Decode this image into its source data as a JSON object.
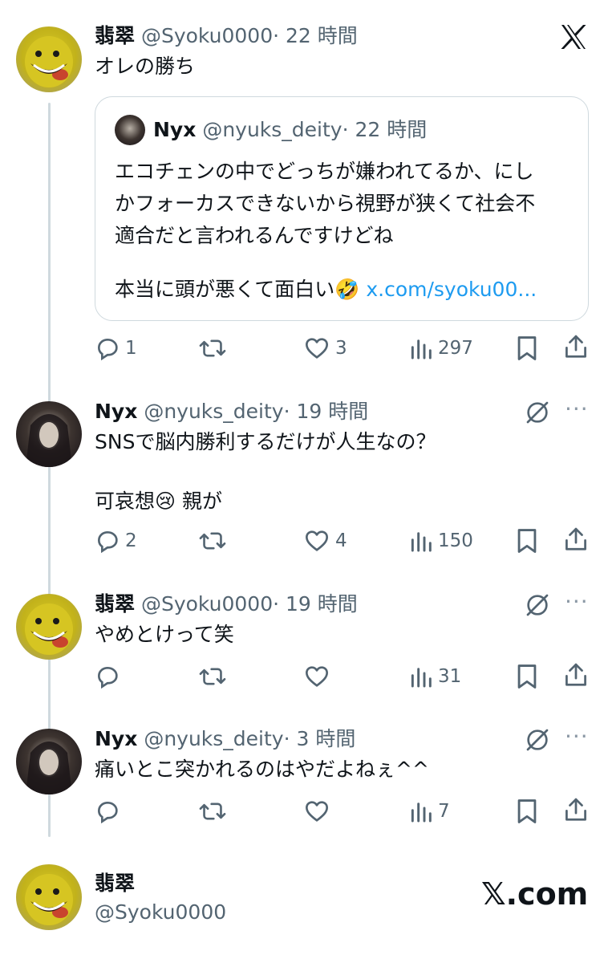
{
  "header": {
    "brand_icon": "x-logo"
  },
  "main_post": {
    "display_name": "翡翠",
    "handle": "@Syoku0000",
    "time": "· 22 時間",
    "text": "オレの勝ち",
    "quote": {
      "display_name": "Nyx",
      "handle": "@nyuks_deity",
      "time": "· 22 時間",
      "lines": [
        "エコチェンの中でどっちが嫌われてるか、にし",
        "かフォーカスできないから視野が狭くて社会不",
        "適合だと言われるんですけどね",
        "本当に頭が悪くて面白い🤣 "
      ],
      "link": "x.com/syoku00..."
    },
    "stats": {
      "replies": "1",
      "reposts": "",
      "likes": "3",
      "views": "297"
    }
  },
  "replies": [
    {
      "display_name": "Nyx",
      "handle": "@nyuks_deity",
      "time": "· 19 時間",
      "lines": [
        "SNSで脳内勝利するだけが人生なの？",
        "可哀想😢 親が"
      ],
      "stats": {
        "replies": "2",
        "reposts": "",
        "likes": "4",
        "views": "150"
      }
    },
    {
      "display_name": "翡翠",
      "handle": "@Syoku0000",
      "time": "· 19 時間",
      "lines": [
        "やめとけって笑"
      ],
      "stats": {
        "replies": "",
        "reposts": "",
        "likes": "",
        "views": "31"
      }
    },
    {
      "display_name": "Nyx",
      "handle": "@nyuks_deity",
      "time": "· 3 時間",
      "lines": [
        "痛いとこ突かれるのはやだよねぇ^^"
      ],
      "stats": {
        "replies": "",
        "reposts": "",
        "likes": "",
        "views": "7"
      }
    }
  ],
  "footer": {
    "display_name": "翡翠",
    "handle": "@Syoku0000",
    "brand": "𝕏.com"
  },
  "menu": {
    "dots": "···"
  }
}
